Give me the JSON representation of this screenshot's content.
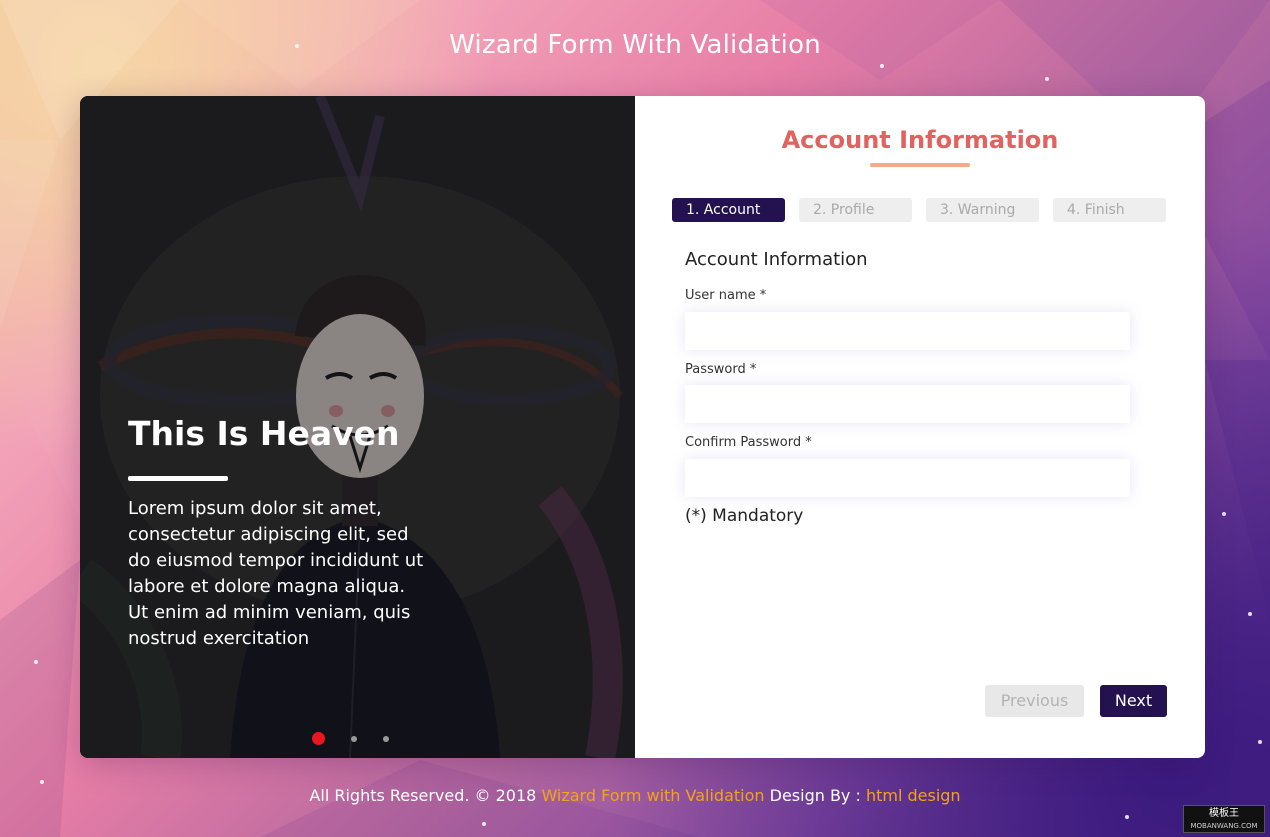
{
  "page": {
    "title": "Wizard Form With Validation"
  },
  "hero": {
    "title": "This Is Heaven",
    "text": "Lorem ipsum dolor sit amet, consectetur adipiscing elit, sed do eiusmod tempor incididunt ut labore et dolore magna aliqua. Ut enim ad minim veniam, quis nostrud exercitation",
    "slide_count": 3,
    "active_slide": 1
  },
  "form": {
    "heading": "Account Information",
    "steps": [
      {
        "label": "1. Account",
        "active": true
      },
      {
        "label": "2. Profile",
        "active": false
      },
      {
        "label": "3. Warning",
        "active": false
      },
      {
        "label": "4. Finish",
        "active": false
      }
    ],
    "section_title": "Account Information",
    "fields": {
      "username": {
        "label": "User name *",
        "value": ""
      },
      "password": {
        "label": "Password *",
        "value": ""
      },
      "confirm_password": {
        "label": "Confirm Password *",
        "value": ""
      }
    },
    "mandatory_note": "(*) Mandatory",
    "previous_label": "Previous",
    "next_label": "Next"
  },
  "footer": {
    "prefix": "All Rights Reserved. © 2018 ",
    "link1": "Wizard Form with Validation",
    "middle": " Design By : ",
    "link2": "html design"
  },
  "badge": {
    "line1": "模板王",
    "line2": "MOBANWANG.COM"
  },
  "colors": {
    "accent_dark": "#23124f",
    "heading": "#e2625f",
    "footer_highlight": "#f2a417",
    "active_dot": "#e8161f"
  }
}
